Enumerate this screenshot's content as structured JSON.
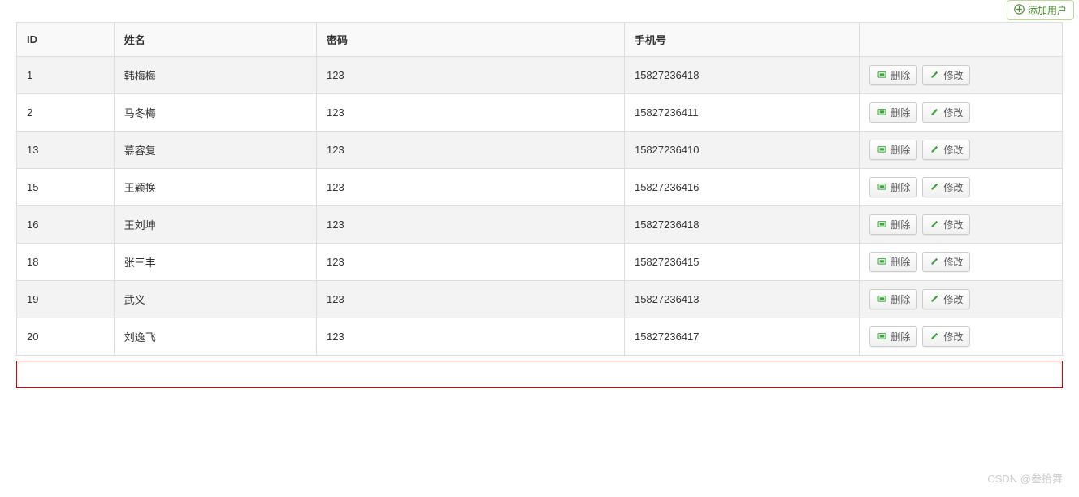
{
  "toolbar": {
    "add_label": "添加用户"
  },
  "table": {
    "headers": {
      "id": "ID",
      "name": "姓名",
      "password": "密码",
      "phone": "手机号"
    },
    "rows": [
      {
        "id": "1",
        "name": "韩梅梅",
        "password": "123",
        "phone": "15827236418"
      },
      {
        "id": "2",
        "name": "马冬梅",
        "password": "123",
        "phone": "15827236411"
      },
      {
        "id": "13",
        "name": "慕容复",
        "password": "123",
        "phone": "15827236410"
      },
      {
        "id": "15",
        "name": "王颖换",
        "password": "123",
        "phone": "15827236416"
      },
      {
        "id": "16",
        "name": "王刘坤",
        "password": "123",
        "phone": "15827236418"
      },
      {
        "id": "18",
        "name": "张三丰",
        "password": "123",
        "phone": "15827236415"
      },
      {
        "id": "19",
        "name": "武义",
        "password": "123",
        "phone": "15827236413"
      },
      {
        "id": "20",
        "name": "刘逸飞",
        "password": "123",
        "phone": "15827236417"
      }
    ]
  },
  "actions": {
    "delete_label": "删除",
    "edit_label": "修改"
  },
  "watermark": "CSDN @叁拾舞"
}
